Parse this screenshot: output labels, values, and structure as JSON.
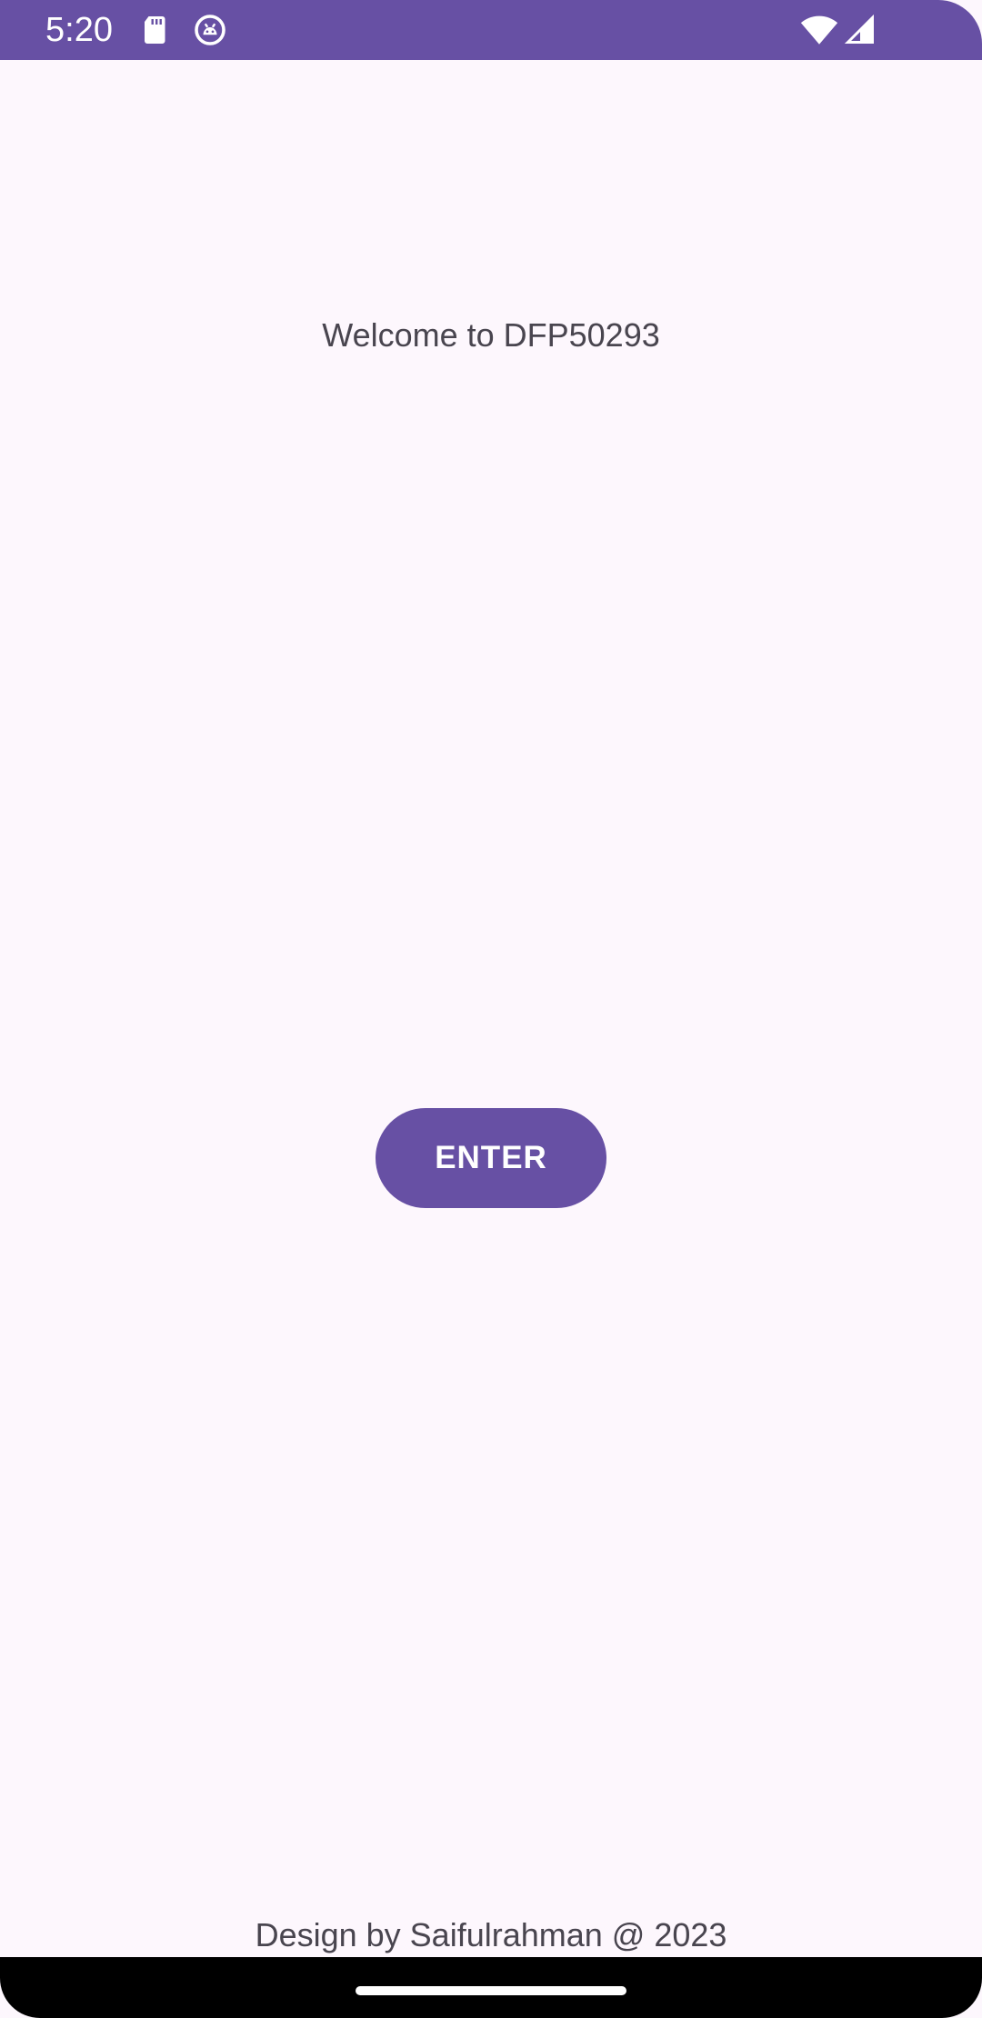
{
  "status_bar": {
    "time": "5:20",
    "background_color": "#6750A4",
    "icons": [
      "sd-card-icon",
      "android-debug-icon",
      "wifi-icon",
      "cellular-signal-icon"
    ]
  },
  "main": {
    "welcome_text": "Welcome to DFP50293",
    "enter_button_label": "ENTER",
    "footer_credit": "Design by Saifulrahman @ 2023"
  },
  "theme": {
    "primary": "#6750A4",
    "background": "#FDF7FD",
    "text": "#49454F"
  }
}
